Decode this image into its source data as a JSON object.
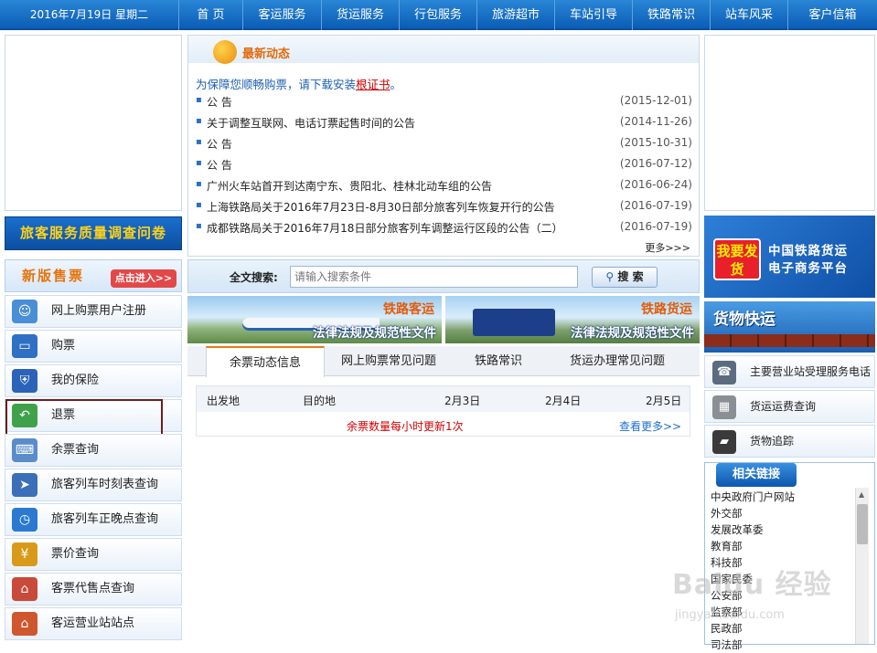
{
  "header": {
    "date": "2016年7月19日 星期二",
    "nav": [
      "首 页",
      "客运服务",
      "货运服务",
      "行包服务",
      "旅游超市",
      "车站引导",
      "铁路常识",
      "站车风采",
      "客户信箱"
    ]
  },
  "left": {
    "survey_banner": "旅客服务质量调查问卷",
    "new_sale_title": "新版售票",
    "new_sale_button": "点击进入>>",
    "menu": [
      {
        "label": "网上购票用户注册",
        "icon": "user-register-icon"
      },
      {
        "label": "购票",
        "icon": "monitor-icon"
      },
      {
        "label": "我的保险",
        "icon": "shield-icon"
      },
      {
        "label": "退票",
        "icon": "return-arrow-icon"
      },
      {
        "label": "余票查询",
        "icon": "keyboard-icon"
      },
      {
        "label": "旅客列车时刻表查询",
        "icon": "train-icon"
      },
      {
        "label": "旅客列车正晚点查询",
        "icon": "clock-icon"
      },
      {
        "label": "票价查询",
        "icon": "yuan-icon"
      },
      {
        "label": "客票代售点查询",
        "icon": "shop-icon"
      },
      {
        "label": "客运营业站站点",
        "icon": "house-icon"
      }
    ]
  },
  "news": {
    "title": "最新动态",
    "tip_prefix": "为保障您顺畅购票，请下载安装",
    "tip_link": "根证书",
    "tip_suffix": "。",
    "items": [
      {
        "title": "公 告",
        "date": "(2015-12-01)"
      },
      {
        "title": "关于调整互联网、电话订票起售时间的公告",
        "date": "(2014-11-26)"
      },
      {
        "title": "公 告",
        "date": "(2015-10-31)"
      },
      {
        "title": "公 告",
        "date": "(2016-07-12)"
      },
      {
        "title": "广州火车站首开到达南宁东、贵阳北、桂林北动车组的公告",
        "date": "(2016-06-24)"
      },
      {
        "title": "上海铁路局关于2016年7月23日-8月30日部分旅客列车恢复开行的公告",
        "date": "(2016-07-19)"
      },
      {
        "title": "成都铁路局关于2016年7月18日部分旅客列车调整运行区段的公告（二）",
        "date": "(2016-07-19)"
      }
    ],
    "more": "更多>>>"
  },
  "search": {
    "label": "全文搜索:",
    "placeholder": "请输入搜索条件",
    "button": "搜 索"
  },
  "banners": [
    {
      "top": "铁路客运",
      "bottom": "法律法规及规范性文件"
    },
    {
      "top": "铁路货运",
      "bottom": "法律法规及规范性文件"
    }
  ],
  "tabs": [
    "余票动态信息",
    "网上购票常见问题",
    "铁路常识",
    "货运办理常见问题"
  ],
  "tickets": {
    "columns": [
      "出发地",
      "目的地",
      "2月3日",
      "2月4日",
      "2月5日"
    ],
    "note": "余票数量每小时更新1次",
    "more": "查看更多>>"
  },
  "right": {
    "freight_ad_button": "我要发货",
    "freight_ad_line1": "中国铁路货运",
    "freight_ad_line2": "电子商务平台",
    "express": "货物快运",
    "menu": [
      {
        "label": "主要营业站受理服务电话",
        "icon": "phone-icon"
      },
      {
        "label": "货运运费查询",
        "icon": "calculator-icon"
      },
      {
        "label": "货物追踪",
        "icon": "locomotive-icon"
      }
    ],
    "links_title": "相关链接",
    "links": [
      "中央政府门户网站",
      "外交部",
      "发展改革委",
      "教育部",
      "科技部",
      "国家民委",
      "公安部",
      "监察部",
      "民政部",
      "司法部"
    ]
  },
  "watermark": {
    "main": "Baidu 经验",
    "sub": "jingyan.baidu.com"
  }
}
